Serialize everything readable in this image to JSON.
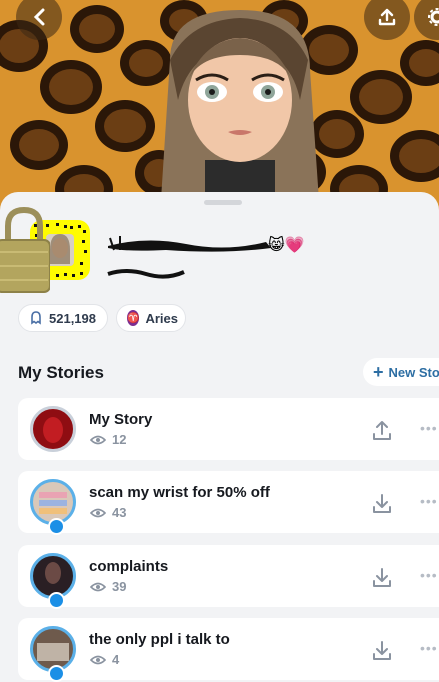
{
  "header": {
    "back_icon": "chevron-left-icon",
    "share_icon": "upload-icon",
    "settings_icon": "gear-icon"
  },
  "profile": {
    "emoji": "😸💗",
    "stats": {
      "score": "521,198",
      "zodiac": "Aries"
    }
  },
  "stories": {
    "section_title": "My Stories",
    "new_story_label": "New Sto",
    "items": [
      {
        "title": "My Story",
        "views": "12",
        "action_icon": "upload-icon",
        "thumb_color": "#8f0d12"
      },
      {
        "title": "scan my wrist for 50% off",
        "views": "43",
        "action_icon": "download-icon",
        "thumb_color": "#d9c8b9"
      },
      {
        "title": "complaints",
        "views": "39",
        "action_icon": "download-icon",
        "thumb_color": "#2a1f24"
      },
      {
        "title": "the only ppl i talk to",
        "views": "4",
        "action_icon": "download-icon",
        "thumb_color": "#6e5a4c"
      }
    ]
  },
  "colors": {
    "accent_blue": "#2d6ea3",
    "snapcode_yellow": "#fffc00",
    "banner_orange": "#d9932e"
  }
}
